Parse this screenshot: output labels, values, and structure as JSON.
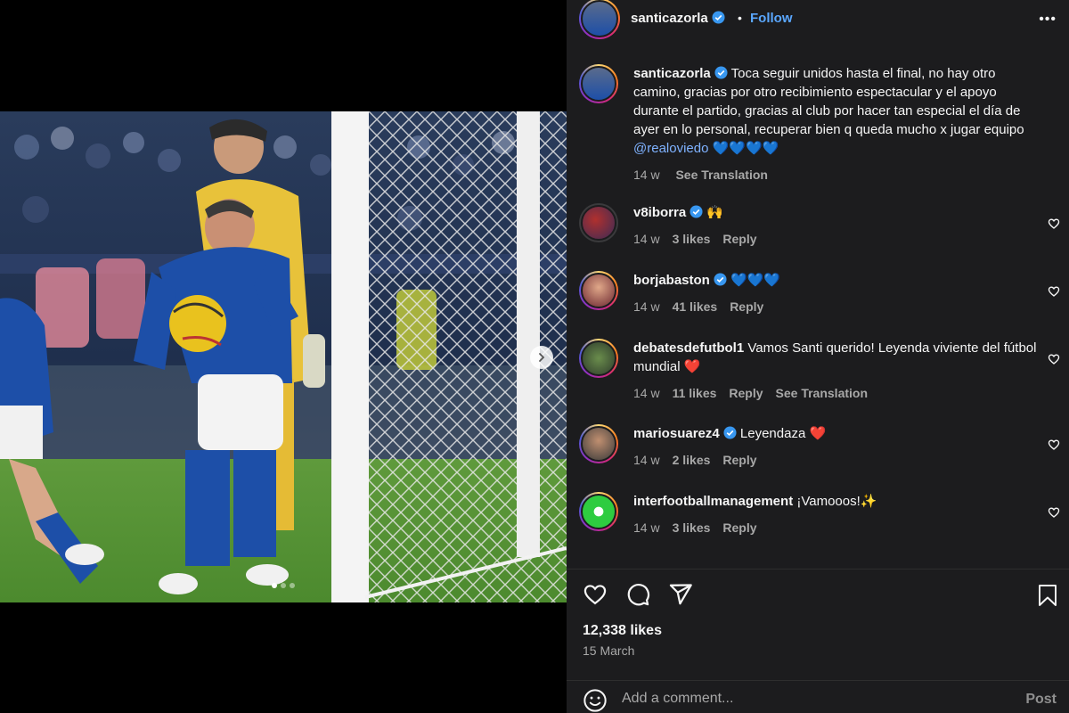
{
  "post": {
    "author": "santicazorla",
    "follow_label": "Follow",
    "separator": "•",
    "more_label": "•••",
    "caption_text": "Toca seguir unidos hasta el final, no hay otro camino, gracias por otro recibimiento espectacular y el apoyo durante el partido, gracias al club por hacer tan especial el día de ayer en lo personal, recuperar bien q queda mucho x jugar equipo ",
    "caption_mention": "@realoviedo",
    "caption_emoji": "💙💙💙💙",
    "caption_age": "14 w",
    "caption_translate": "See Translation",
    "likes": "12,338 likes",
    "date": "15 March",
    "carousel_dots": 3,
    "carousel_active": 0
  },
  "comments": [
    {
      "user": "v8iborra",
      "verified": true,
      "text": "🙌",
      "age": "14 w",
      "likes": "3 likes",
      "reply": "Reply",
      "translate": ""
    },
    {
      "user": "borjabaston",
      "verified": true,
      "text": "💙💙💙",
      "age": "14 w",
      "likes": "41 likes",
      "reply": "Reply",
      "translate": ""
    },
    {
      "user": "debatesdefutbol1",
      "verified": false,
      "text": "Vamos Santi querido! Leyenda viviente del fútbol mundial ❤️",
      "age": "14 w",
      "likes": "11 likes",
      "reply": "Reply",
      "translate": "See Translation"
    },
    {
      "user": "mariosuarez4",
      "verified": true,
      "text": "Leyendaza ❤️",
      "age": "14 w",
      "likes": "2 likes",
      "reply": "Reply",
      "translate": ""
    },
    {
      "user": "interfootballmanagement",
      "verified": false,
      "text": "¡Vamooos!✨",
      "age": "14 w",
      "likes": "3 likes",
      "reply": "Reply",
      "translate": ""
    }
  ],
  "composer": {
    "placeholder": "Add a comment...",
    "post_label": "Post"
  },
  "colors": {
    "panel_bg": "#1c1c1e",
    "accent_link": "#5aa7ff",
    "verified_badge": "#3897f0",
    "kit_blue": "#1d4fa8",
    "keeper_yellow": "#e8c23a"
  }
}
